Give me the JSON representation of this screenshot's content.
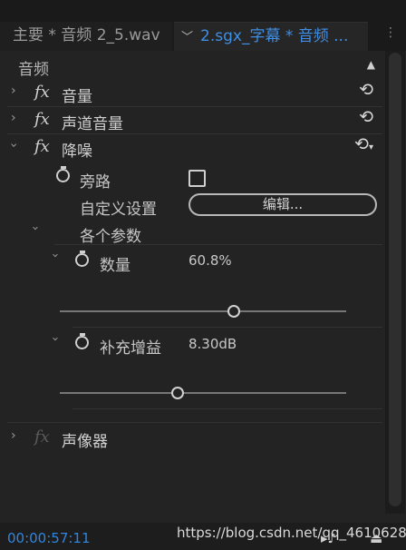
{
  "tabs": [
    {
      "label": "主要 * 音频 2_5.wav"
    },
    {
      "label": "2.sgx_字幕 * 音频 ..."
    }
  ],
  "section": {
    "title": "音频"
  },
  "effects": [
    {
      "label": "音量"
    },
    {
      "label": "声道音量"
    },
    {
      "label": "降噪"
    },
    {
      "label": "声像器"
    }
  ],
  "denoise": {
    "bypass_label": "旁路",
    "custom_label": "自定义设置",
    "edit_button": "编辑...",
    "params_label": "各个参数",
    "amount_label": "数量",
    "amount_value": "60.8%",
    "amount_fraction": 0.608,
    "gain_label": "补充增益",
    "gain_value": "8.30dB",
    "gain_fraction": 0.41
  },
  "footer": {
    "timecode": "00:00:57:11",
    "watermark": "https://blog.csdn.net/qq_46106285"
  },
  "icons": {
    "fx": "fx",
    "reset": "⟲",
    "tab_menu": "⋮"
  }
}
